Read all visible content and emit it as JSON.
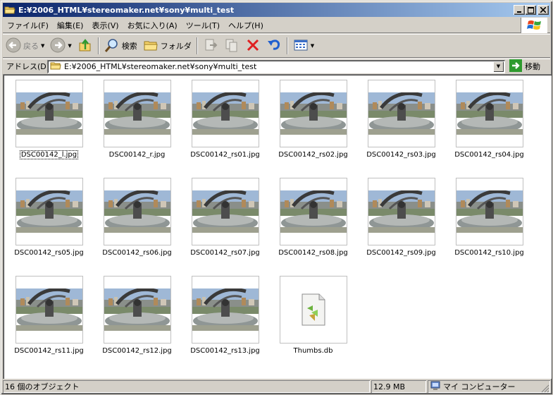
{
  "window": {
    "title": "E:¥2006_HTML¥stereomaker.net¥sony¥multi_test",
    "minimize": "_",
    "maximize": "□",
    "close": "×"
  },
  "menu": [
    {
      "label": "ファイル(F)"
    },
    {
      "label": "編集(E)"
    },
    {
      "label": "表示(V)"
    },
    {
      "label": "お気に入り(A)"
    },
    {
      "label": "ツール(T)"
    },
    {
      "label": "ヘルプ(H)"
    }
  ],
  "toolbar": {
    "back_label": "戻る",
    "search_label": "検索",
    "folders_label": "フォルダ"
  },
  "address": {
    "label": "アドレス(D)",
    "value": "E:¥2006_HTML¥stereomaker.net¥sony¥multi_test",
    "go_label": "移動"
  },
  "files": [
    {
      "name": "DSC00142_l.jpg",
      "type": "image"
    },
    {
      "name": "DSC00142_r.jpg",
      "type": "image"
    },
    {
      "name": "DSC00142_rs01.jpg",
      "type": "image"
    },
    {
      "name": "DSC00142_rs02.jpg",
      "type": "image"
    },
    {
      "name": "DSC00142_rs03.jpg",
      "type": "image"
    },
    {
      "name": "DSC00142_rs04.jpg",
      "type": "image"
    },
    {
      "name": "DSC00142_rs05.jpg",
      "type": "image"
    },
    {
      "name": "DSC00142_rs06.jpg",
      "type": "image"
    },
    {
      "name": "DSC00142_rs07.jpg",
      "type": "image"
    },
    {
      "name": "DSC00142_rs08.jpg",
      "type": "image"
    },
    {
      "name": "DSC00142_rs09.jpg",
      "type": "image"
    },
    {
      "name": "DSC00142_rs10.jpg",
      "type": "image"
    },
    {
      "name": "DSC00142_rs11.jpg",
      "type": "image"
    },
    {
      "name": "DSC00142_rs12.jpg",
      "type": "image"
    },
    {
      "name": "DSC00142_rs13.jpg",
      "type": "image"
    },
    {
      "name": "Thumbs.db",
      "type": "file"
    }
  ],
  "status": {
    "count": "16 個のオブジェクト",
    "size": "12.9 MB",
    "location": "マイ コンピューター"
  },
  "colors": {
    "title_start": "#0a246a",
    "title_end": "#a6caf0",
    "chrome": "#d4d0c8",
    "go_green": "#2e9a2e"
  },
  "icons": [
    "folder-icon",
    "back-arrow-icon",
    "forward-arrow-icon",
    "up-folder-icon",
    "search-icon",
    "folders-icon",
    "move-to-icon",
    "copy-to-icon",
    "delete-icon",
    "undo-icon",
    "views-icon",
    "windows-logo-icon",
    "go-arrow-icon",
    "computer-icon"
  ]
}
